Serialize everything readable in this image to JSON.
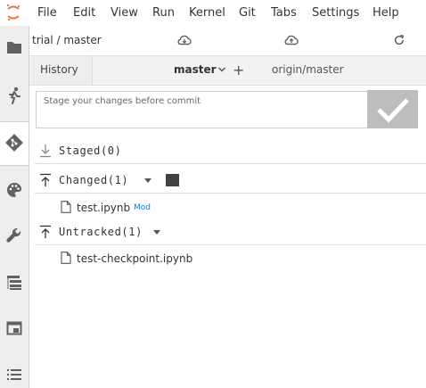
{
  "menu": {
    "items": [
      "File",
      "Edit",
      "View",
      "Run",
      "Kernel",
      "Git",
      "Tabs",
      "Settings",
      "Help"
    ]
  },
  "sidebar": {
    "icons": [
      "folder-icon",
      "running-icon",
      "git-icon",
      "palette-icon",
      "wrench-icon",
      "table-of-contents-icon",
      "tabs-icon",
      "list-icon"
    ],
    "active": "git-icon"
  },
  "git_panel": {
    "repo": "trial / master",
    "branch_tab": {
      "history_label": "History",
      "current_branch": "master",
      "remote_branch": "origin/master"
    },
    "commit": {
      "placeholder": "Stage your changes before commit",
      "value": ""
    },
    "staged": {
      "title": "Staged(0)"
    },
    "changed": {
      "title": "Changed(1)",
      "files": [
        {
          "name": "test.ipynb",
          "status": "Mod"
        }
      ]
    },
    "untracked": {
      "title": "Untracked(1)",
      "files": [
        {
          "name": "test-checkpoint.ipynb"
        }
      ]
    }
  },
  "colors": {
    "accent_orange": "#f37726",
    "status_blue": "#1976d2",
    "commit_button": "#bdbdbd",
    "sidebar_bg": "#eeeeee"
  }
}
